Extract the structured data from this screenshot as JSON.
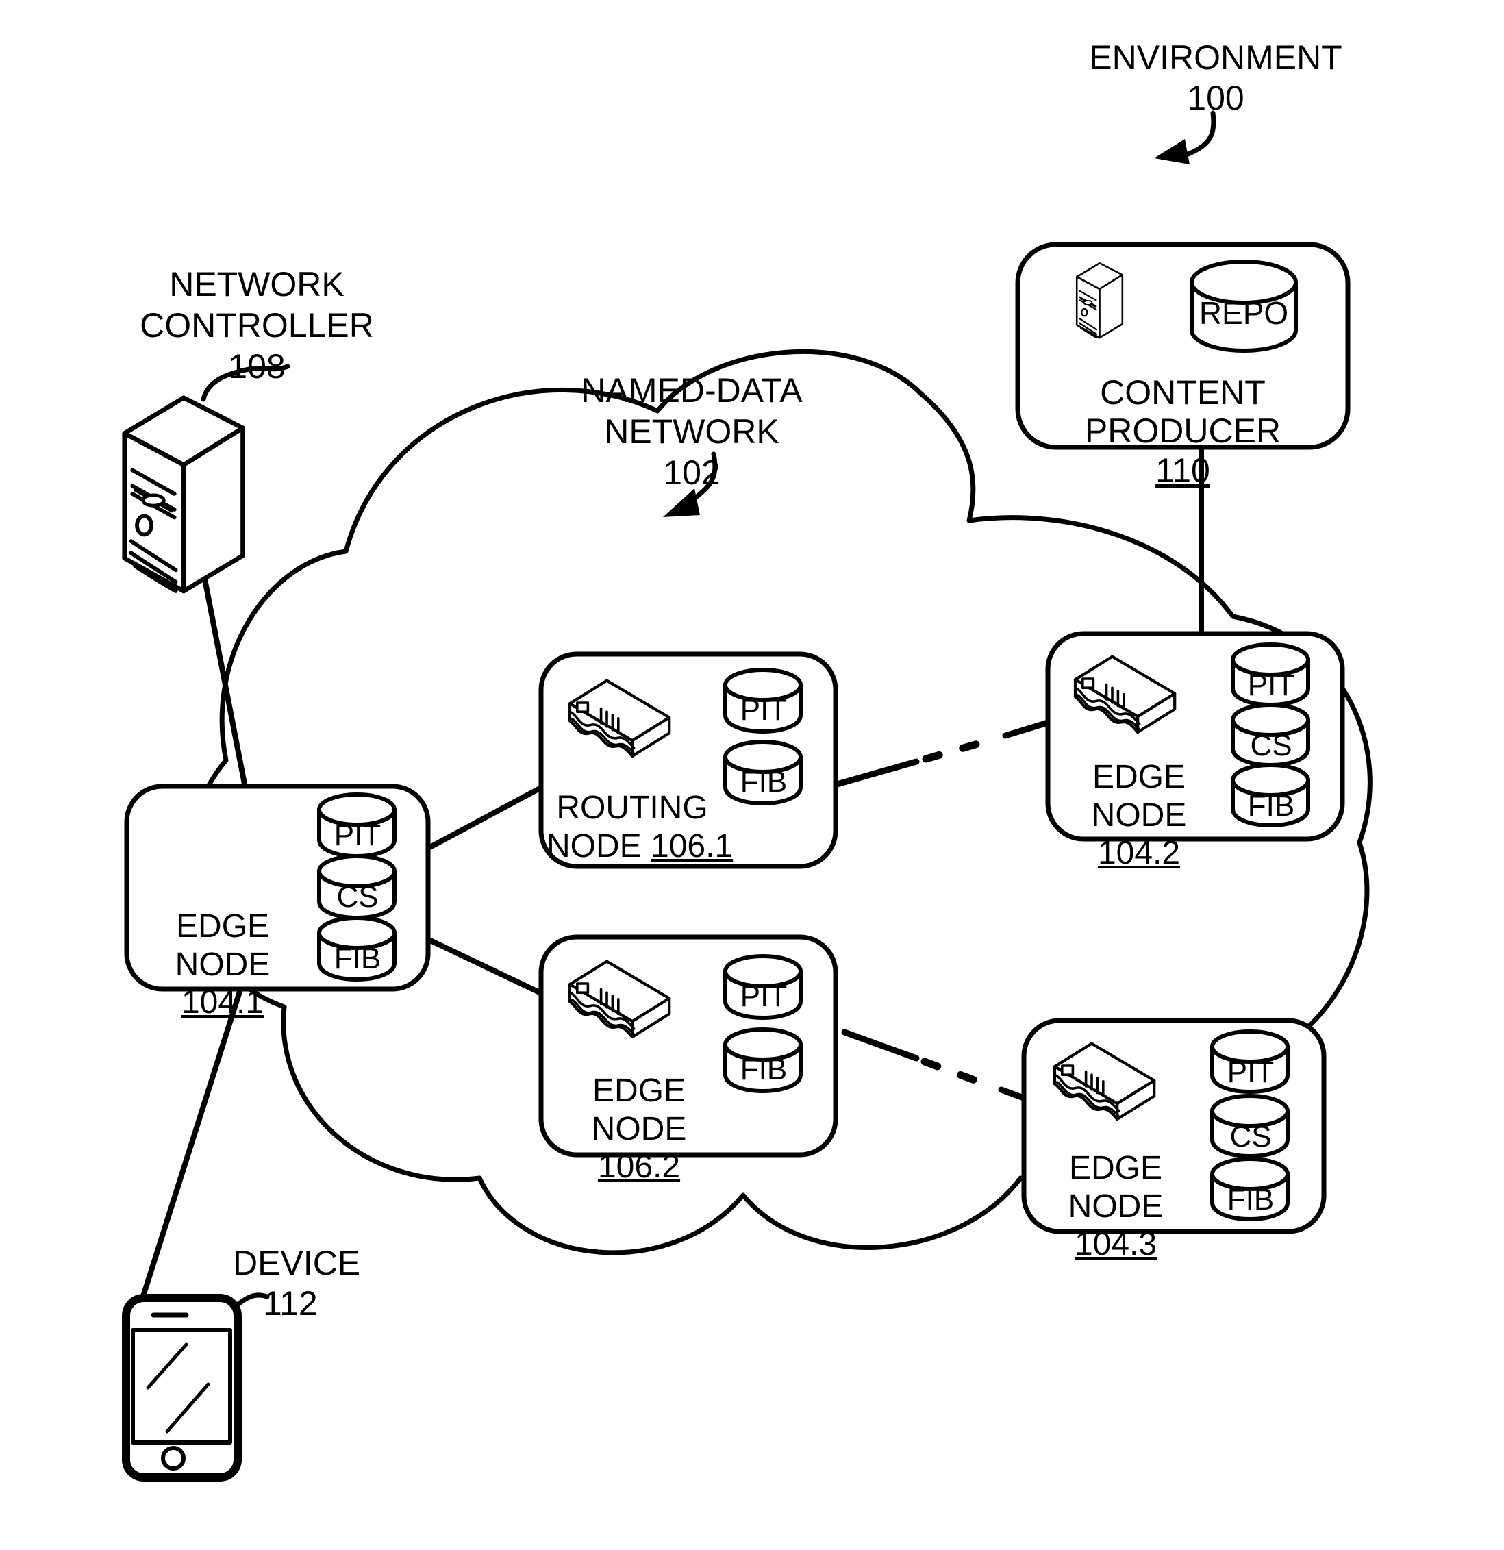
{
  "figure": {
    "title": "ENVIRONMENT",
    "environment": {
      "label": "ENVIRONMENT",
      "ref": "100"
    },
    "network": {
      "label_line1": "NAMED-DATA",
      "label_line2": "NETWORK",
      "ref": "102"
    }
  },
  "network_controller": {
    "label_line1": "NETWORK",
    "label_line2": "CONTROLLER",
    "ref": "108",
    "icon": "server-tower-icon"
  },
  "content_producer": {
    "label": "CONTENT PRODUCER",
    "ref": "110",
    "icon": "server-tower-icon",
    "store": {
      "label": "REPO",
      "icon": "database-cylinder-icon"
    }
  },
  "device": {
    "label": "DEVICE",
    "ref": "112",
    "icon": "smartphone-icon"
  },
  "nodes": [
    {
      "id": "edge-node-104-1",
      "label": "EDGE NODE",
      "ref": "104.1",
      "label_layout": "two-line",
      "icon": "router-switch-icon",
      "stores": [
        "PIT",
        "CS",
        "FIB"
      ]
    },
    {
      "id": "routing-node-106-1",
      "label_line1": "ROUTING",
      "label_line2": "NODE",
      "label": "ROUTING NODE",
      "ref": "106.1",
      "label_layout": "wrapped-inline",
      "icon": "router-switch-icon",
      "stores": [
        "PIT",
        "FIB"
      ]
    },
    {
      "id": "edge-node-104-2",
      "label": "EDGE NODE",
      "ref": "104.2",
      "label_layout": "two-line",
      "icon": "router-switch-icon",
      "stores": [
        "PIT",
        "CS",
        "FIB"
      ]
    },
    {
      "id": "edge-node-106-2",
      "label": "EDGE NODE",
      "ref": "106.2",
      "label_layout": "two-line",
      "icon": "router-switch-icon",
      "stores": [
        "PIT",
        "FIB"
      ]
    },
    {
      "id": "edge-node-104-3",
      "label": "EDGE NODE",
      "ref": "104.3",
      "label_layout": "two-line",
      "icon": "router-switch-icon",
      "stores": [
        "PIT",
        "CS",
        "FIB"
      ]
    }
  ],
  "connections": [
    {
      "from": "network-controller-108",
      "to": "edge-node-104-1",
      "style": "solid"
    },
    {
      "from": "device-112",
      "to": "edge-node-104-1",
      "style": "solid"
    },
    {
      "from": "edge-node-104-1",
      "to": "routing-node-106-1",
      "style": "solid"
    },
    {
      "from": "edge-node-104-1",
      "to": "edge-node-106-2",
      "style": "solid"
    },
    {
      "from": "routing-node-106-1",
      "to": "edge-node-104-2",
      "style": "dashed-middle"
    },
    {
      "from": "edge-node-106-2",
      "to": "edge-node-104-3",
      "style": "dashed-middle"
    },
    {
      "from": "content-producer-110",
      "to": "edge-node-104-2",
      "style": "solid"
    }
  ],
  "colors": {
    "ink": "#000000",
    "paper": "#ffffff"
  }
}
